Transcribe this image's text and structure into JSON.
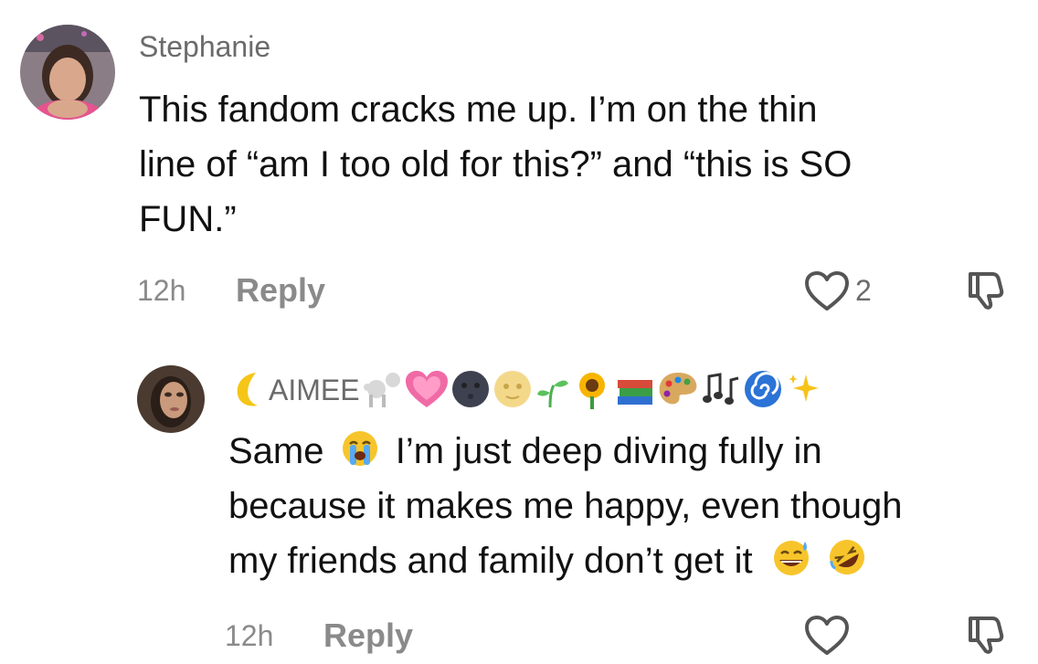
{
  "comments": [
    {
      "author": "Stephanie",
      "text_lines": [
        "This fandom cracks me up. I’m on the thin",
        "line of “am I too old for this?” and “this is SO",
        "FUN.”"
      ],
      "time": "12h",
      "reply_label": "Reply",
      "like_count": "2",
      "icons": {
        "like": "heart-outline-icon",
        "dislike": "thumbs-down-icon"
      }
    },
    {
      "author": "AIMEE",
      "author_emojis": [
        "crescent-moon",
        "poodle",
        "growing-heart",
        "new-moon-face",
        "full-moon-face",
        "seedling",
        "sunflower",
        "books",
        "artist-palette",
        "musical-notes",
        "cyclone",
        "sparkles"
      ],
      "text_first_word": "Same",
      "text_first_line_rest": "I’m just deep diving fully in",
      "text_line2": "because it makes me happy, even though",
      "text_line3": "my friends and family don’t get it",
      "text_emojis": [
        "loudly-crying-face",
        "grinning-sweat-face",
        "rolling-on-floor-laughing"
      ],
      "time": "12h",
      "reply_label": "Reply",
      "icons": {
        "like": "heart-outline-icon",
        "dislike": "thumbs-down-icon"
      }
    }
  ],
  "colors": {
    "text": "#111111",
    "secondary": "#8a8a8a",
    "author": "#6b6b6b"
  }
}
